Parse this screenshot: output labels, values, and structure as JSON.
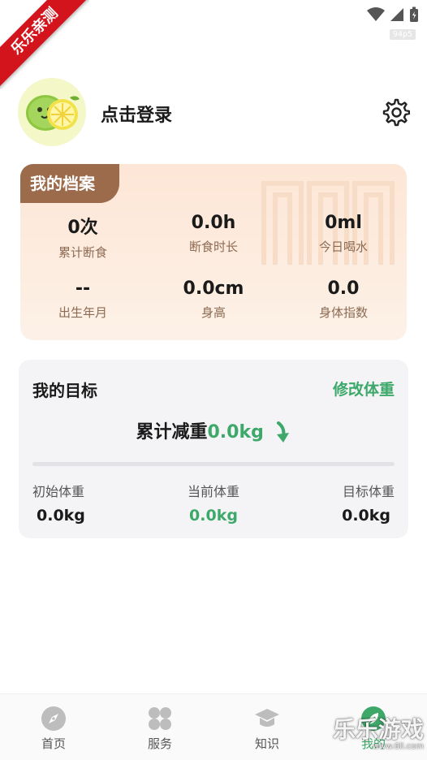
{
  "status_bar": {
    "fps": "94p5"
  },
  "ribbon": {
    "text": "乐乐亲测"
  },
  "header": {
    "login_text": "点击登录"
  },
  "profile": {
    "tag": "我的档案",
    "stats": [
      {
        "value": "0次",
        "label": "累计断食"
      },
      {
        "value": "0.0h",
        "label": "断食时长"
      },
      {
        "value": "0ml",
        "label": "今日喝水"
      },
      {
        "value": "--",
        "label": "出生年月"
      },
      {
        "value": "0.0cm",
        "label": "身高"
      },
      {
        "value": "0.0",
        "label": "身体指数"
      }
    ]
  },
  "goal": {
    "title": "我的目标",
    "edit_label": "修改体重",
    "loss_label": "累计减重",
    "loss_value": "0.0kg",
    "weights": [
      {
        "label": "初始体重",
        "value": "0.0kg"
      },
      {
        "label": "当前体重",
        "value": "0.0kg"
      },
      {
        "label": "目标体重",
        "value": "0.0kg"
      }
    ]
  },
  "nav": {
    "items": [
      {
        "label": "首页",
        "icon": "compass-icon"
      },
      {
        "label": "服务",
        "icon": "clover-icon"
      },
      {
        "label": "知识",
        "icon": "graduation-cap-icon"
      },
      {
        "label": "我的",
        "icon": "leaf-icon"
      }
    ],
    "active_index": 3
  },
  "watermark": {
    "text": "乐乐游戏",
    "sub": "www.6ll.com"
  },
  "colors": {
    "accent": "#3ea86a",
    "profile_tag": "#9b6b4c",
    "ribbon": "#d4141c"
  }
}
